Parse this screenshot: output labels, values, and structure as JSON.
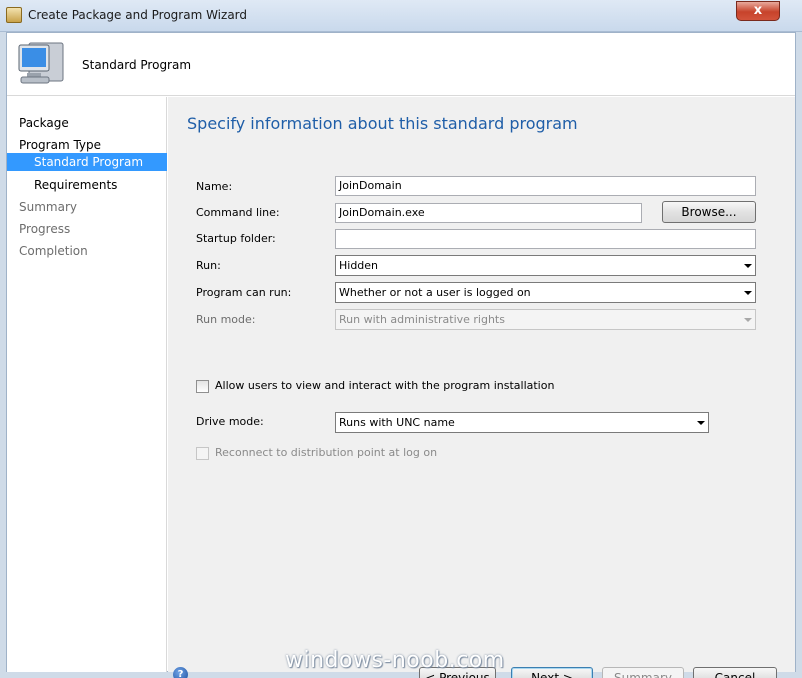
{
  "window": {
    "title": "Create Package and Program Wizard",
    "close_glyph": "x"
  },
  "header": {
    "title": "Standard Program"
  },
  "nav": {
    "items": [
      {
        "label": "Package"
      },
      {
        "label": "Program Type"
      },
      {
        "label": "Standard Program"
      },
      {
        "label": "Requirements"
      },
      {
        "label": "Summary"
      },
      {
        "label": "Progress"
      },
      {
        "label": "Completion"
      }
    ]
  },
  "main": {
    "heading": "Specify information about this standard program",
    "name_label": "Name:",
    "name_value": "JoinDomain",
    "command_label": "Command line:",
    "command_value": "JoinDomain.exe",
    "browse_label": "Browse...",
    "startup_label": "Startup folder:",
    "startup_value": "",
    "run_label": "Run:",
    "run_value": "Hidden",
    "can_run_label": "Program can run:",
    "can_run_value": "Whether or not a user is logged on",
    "run_mode_label": "Run mode:",
    "run_mode_value": "Run with administrative rights",
    "allow_users_label": "Allow users to view and interact with the program installation",
    "drive_mode_label": "Drive mode:",
    "drive_mode_value": "Runs with UNC name",
    "reconnect_label": "Reconnect to distribution point at log on"
  },
  "footer": {
    "help_glyph": "?",
    "previous_label": "< Previous",
    "next_label": "Next >",
    "summary_label": "Summary",
    "cancel_label": "Cancel"
  },
  "watermark": "windows-noob.com"
}
